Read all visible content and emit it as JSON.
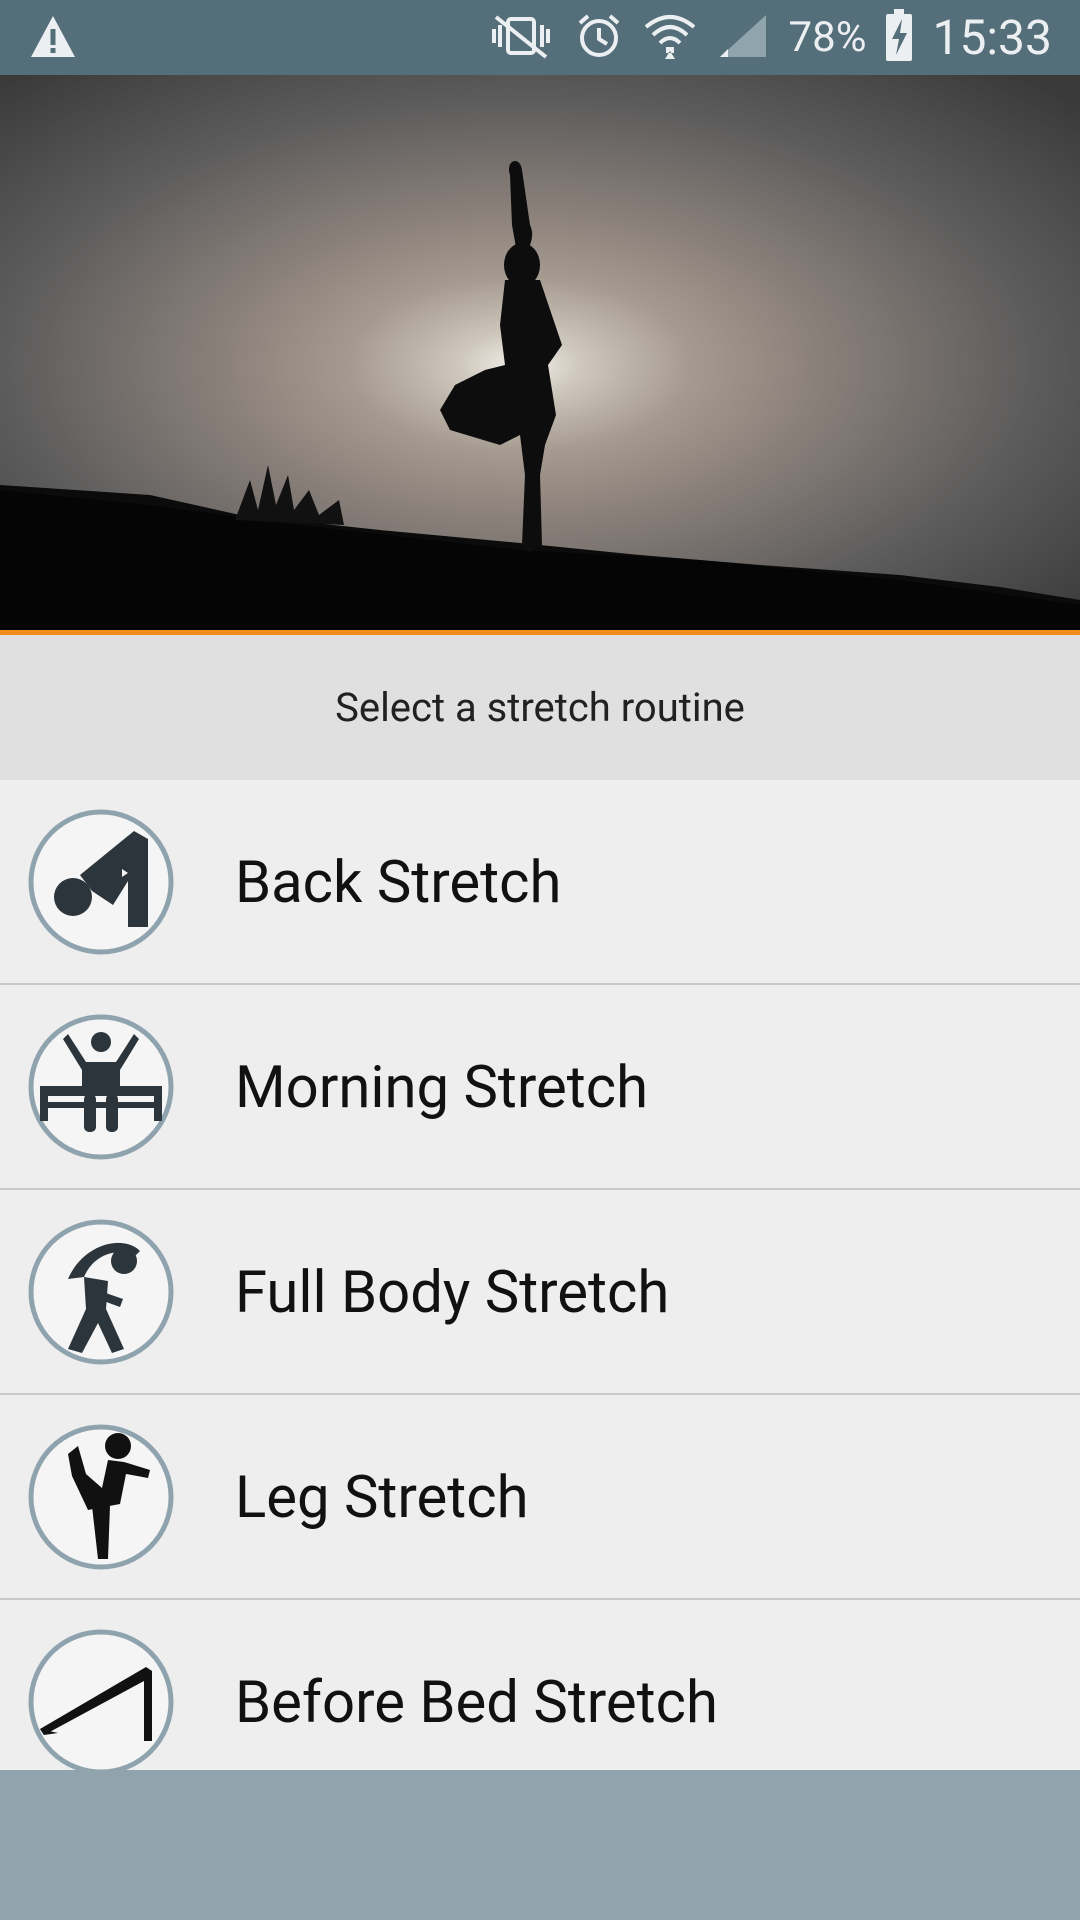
{
  "status_bar": {
    "battery_percent": "78%",
    "time": "15:33",
    "icons": [
      "warning-icon",
      "vibrate-mute-icon",
      "alarm-icon",
      "wifi-icon",
      "signal-icon",
      "battery-charging-icon"
    ]
  },
  "header": {
    "title": "Select a stretch routine"
  },
  "routines": [
    {
      "label": "Back Stretch",
      "icon": "back-stretch-icon"
    },
    {
      "label": "Morning Stretch",
      "icon": "morning-stretch-icon"
    },
    {
      "label": "Full Body Stretch",
      "icon": "full-body-stretch-icon"
    },
    {
      "label": "Leg Stretch",
      "icon": "leg-stretch-icon"
    },
    {
      "label": "Before Bed Stretch",
      "icon": "before-bed-stretch-icon"
    }
  ],
  "colors": {
    "status_bar": "#546e7a",
    "accent_rule": "#f28c1a",
    "header_bg": "#e0e0e0",
    "list_bg": "#eeeeee",
    "bottom_bar": "#91a4ae",
    "icon_ring": "#8fa3ae"
  }
}
